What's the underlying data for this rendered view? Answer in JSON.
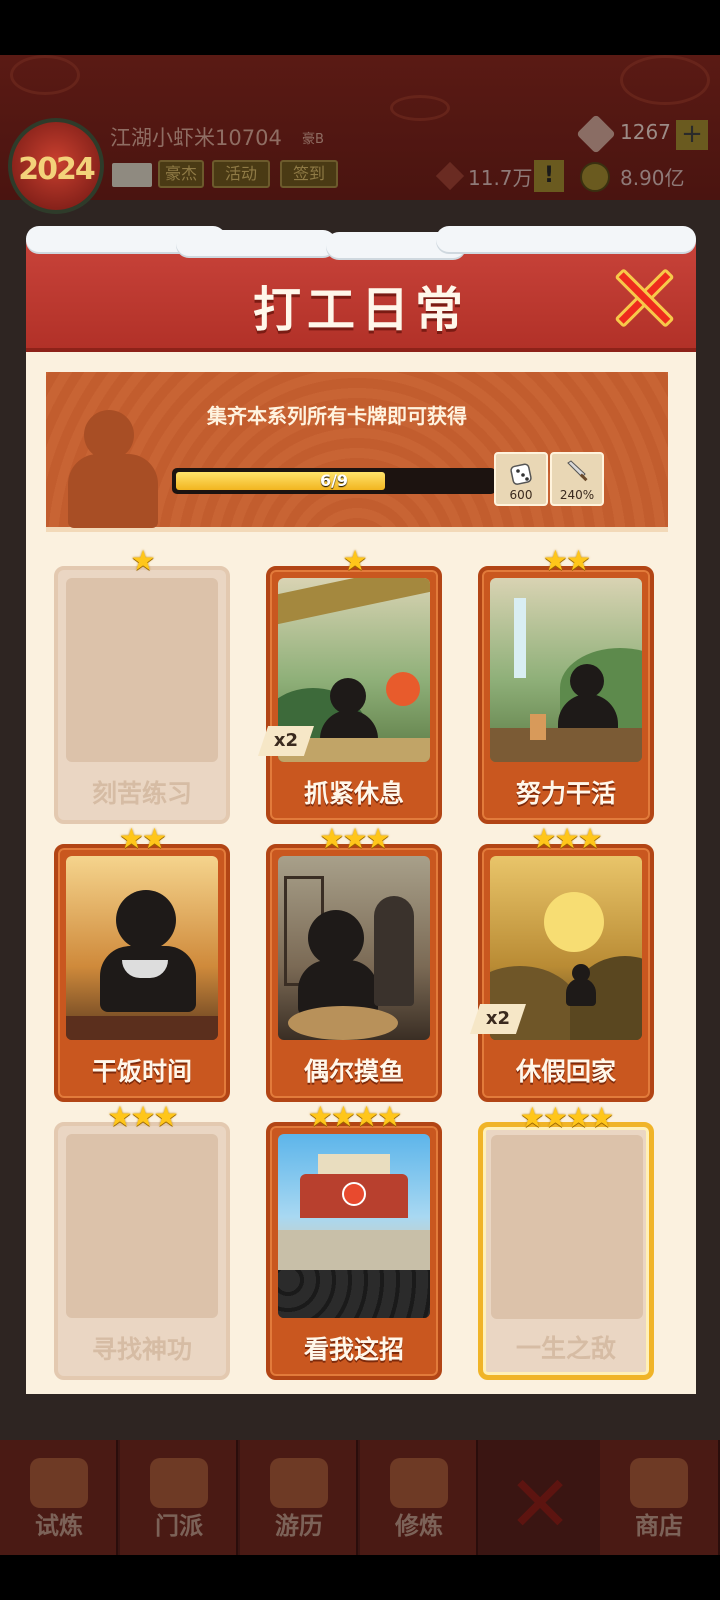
{
  "hud": {
    "player_name": "江湖小虾米10704",
    "player_tag": "豪B",
    "gems": "1267",
    "power": "11.7万",
    "coins": "8.90亿",
    "avatar_text": "2024",
    "buttons": [
      "豪杰",
      "活动",
      "签到"
    ]
  },
  "modal": {
    "title": "打工日常",
    "banner": {
      "text": "集齐本系列所有卡牌即可获得",
      "progress_text": "6/9",
      "progress_value": 0.667,
      "rewards": [
        {
          "icon": "dice-icon",
          "label": "600"
        },
        {
          "icon": "sword-icon",
          "label": "240%"
        }
      ]
    },
    "cards": [
      {
        "name": "刻苦练习",
        "stars": "★",
        "owned": false,
        "badge": ""
      },
      {
        "name": "抓紧休息",
        "stars": "★",
        "owned": true,
        "badge": "x2"
      },
      {
        "name": "努力干活",
        "stars": "★★",
        "owned": true,
        "badge": ""
      },
      {
        "name": "干饭时间",
        "stars": "★★",
        "owned": true,
        "badge": ""
      },
      {
        "name": "偶尔摸鱼",
        "stars": "★★★",
        "owned": true,
        "badge": ""
      },
      {
        "name": "休假回家",
        "stars": "★★★",
        "owned": true,
        "badge": "x2"
      },
      {
        "name": "寻找神功",
        "stars": "★★★",
        "owned": false,
        "badge": ""
      },
      {
        "name": "看我这招",
        "stars": "★★★★",
        "owned": true,
        "badge": ""
      },
      {
        "name": "一生之敌",
        "stars": "★★★★",
        "owned": false,
        "badge": ""
      }
    ]
  },
  "nav": {
    "items": [
      "试炼",
      "门派",
      "游历",
      "修炼",
      "商店"
    ]
  },
  "colors": {
    "header_red": "#c8433a",
    "card_orange": "#c9571f",
    "star_gold": "#ffc61a",
    "panel_cream": "#fbf1df"
  }
}
